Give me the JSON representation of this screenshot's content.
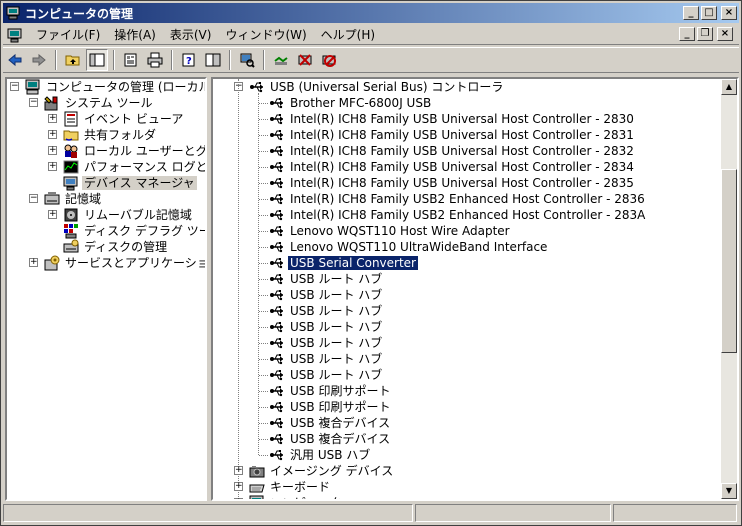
{
  "window": {
    "title": "コンピュータの管理"
  },
  "menu": [
    "ファイル(F)",
    "操作(A)",
    "表示(V)",
    "ウィンドウ(W)",
    "ヘルプ(H)"
  ],
  "toolbar_icons": [
    "back-arrow-icon",
    "forward-arrow-icon",
    "up-folder-icon",
    "show-tree-icon",
    "properties-icon",
    "print-icon",
    "help-icon",
    "console-icon",
    "scan-hardware-icon",
    "update-driver-icon",
    "disable-device-icon",
    "uninstall-device-icon"
  ],
  "tree": [
    {
      "label": "コンピュータの管理 (ローカル)",
      "level": 0,
      "icon": "computer-icon",
      "toggle": "minus"
    },
    {
      "label": "システム ツール",
      "level": 1,
      "icon": "tools-icon",
      "toggle": "minus"
    },
    {
      "label": "イベント ビューア",
      "level": 2,
      "icon": "event-viewer-icon",
      "toggle": "plus"
    },
    {
      "label": "共有フォルダ",
      "level": 2,
      "icon": "shared-folder-icon",
      "toggle": "plus"
    },
    {
      "label": "ローカル ユーザーとグループ",
      "level": 2,
      "icon": "users-icon",
      "toggle": "plus"
    },
    {
      "label": "パフォーマンス ログと警告",
      "level": 2,
      "icon": "performance-icon",
      "toggle": "plus"
    },
    {
      "label": "デバイス マネージャ",
      "level": 2,
      "icon": "device-manager-icon",
      "toggle": "none",
      "selected": true
    },
    {
      "label": "記憶域",
      "level": 1,
      "icon": "storage-icon",
      "toggle": "minus"
    },
    {
      "label": "リムーバブル記憶域",
      "level": 2,
      "icon": "removable-storage-icon",
      "toggle": "plus"
    },
    {
      "label": "ディスク デフラグ ツール",
      "level": 2,
      "icon": "defrag-icon",
      "toggle": "none"
    },
    {
      "label": "ディスクの管理",
      "level": 2,
      "icon": "disk-management-icon",
      "toggle": "none"
    },
    {
      "label": "サービスとアプリケーション",
      "level": 1,
      "icon": "services-icon",
      "toggle": "plus"
    }
  ],
  "devices": {
    "category": "USB (Universal Serial Bus) コントローラ",
    "items": [
      "Brother MFC-6800J USB",
      "Intel(R) ICH8 Family USB Universal Host Controller - 2830",
      "Intel(R) ICH8 Family USB Universal Host Controller - 2831",
      "Intel(R) ICH8 Family USB Universal Host Controller - 2832",
      "Intel(R) ICH8 Family USB Universal Host Controller - 2834",
      "Intel(R) ICH8 Family USB Universal Host Controller - 2835",
      "Intel(R) ICH8 Family USB2 Enhanced Host Controller - 2836",
      "Intel(R) ICH8 Family USB2 Enhanced Host Controller - 283A",
      "Lenovo WQST110 Host Wire Adapter",
      "Lenovo WQST110 UltraWideBand Interface",
      "USB Serial Converter",
      "USB ルート ハブ",
      "USB ルート ハブ",
      "USB ルート ハブ",
      "USB ルート ハブ",
      "USB ルート ハブ",
      "USB ルート ハブ",
      "USB ルート ハブ",
      "USB 印刷サポート",
      "USB 印刷サポート",
      "USB 複合デバイス",
      "USB 複合デバイス",
      "汎用 USB ハブ"
    ],
    "selected_index": 10,
    "after": [
      {
        "label": "イメージング デバイス",
        "icon": "camera-icon"
      },
      {
        "label": "キーボード",
        "icon": "keyboard-icon"
      },
      {
        "label": "コンピュータ",
        "icon": "computer-icon"
      }
    ]
  },
  "colors": {
    "selection": "#0a246a",
    "titlebar_start": "#0a246a",
    "titlebar_end": "#a6caf0",
    "face": "#d4d0c8"
  }
}
